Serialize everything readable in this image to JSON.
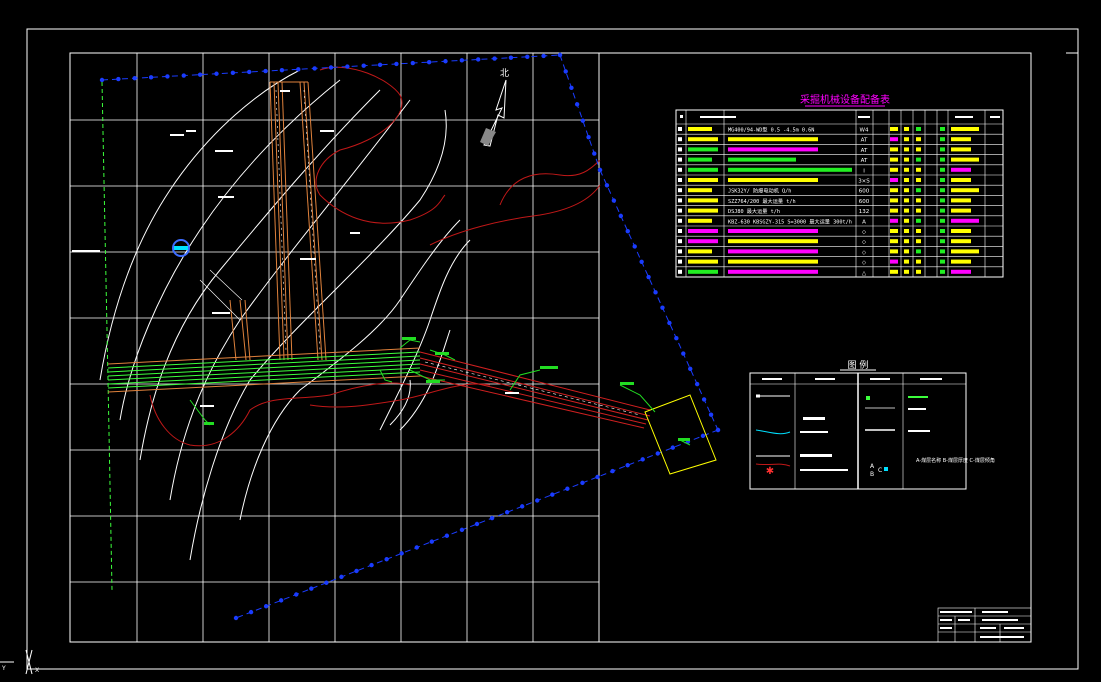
{
  "colors": {
    "background": "#000000",
    "frame": "#ffffff",
    "boundary_blue": "#1a3cff",
    "contour_white": "#ffffff",
    "contour_red": "#c01818",
    "pipe_green": "#3cff3c",
    "highlight_yellow": "#ffff00",
    "highlight_magenta": "#ff00ff",
    "highlight_green": "#22ee22",
    "roadway_orange": "#e0823c",
    "roadway_red": "#d02020",
    "label_green": "#22dd22",
    "label_cyan": "#00e0ff"
  },
  "north_label": "北",
  "cursor_axes": {
    "x_label": "X",
    "y_label": "Y"
  },
  "equipment_table": {
    "title": "采掘机械设备配备表",
    "rows": [
      {
        "spec": "MG400/94-WD型 0.5 -4.5m 0.6N",
        "code": "W4"
      },
      {
        "spec": "",
        "code": "AT"
      },
      {
        "spec": "",
        "code": "AT"
      },
      {
        "spec": "",
        "code": "AT"
      },
      {
        "spec": "",
        "code": "I"
      },
      {
        "spec": "",
        "code": "3×S"
      },
      {
        "spec": "JSK32Y/ 防爆电动机 Q/h",
        "code": "600"
      },
      {
        "spec": "SZZ764/200 最大运量 t/h",
        "code": "600"
      },
      {
        "spec": "DSJ80 最大运量 t/h",
        "code": "132"
      },
      {
        "spec": "KBZ-630 KBSGZY-315 S=3000 最大运量 300t/h",
        "code": "A"
      },
      {
        "spec": "",
        "code": "◇"
      },
      {
        "spec": "",
        "code": "◇"
      },
      {
        "spec": "",
        "code": "◇"
      },
      {
        "spec": "",
        "code": "◇"
      },
      {
        "spec": "",
        "code": "△"
      }
    ]
  },
  "legend": {
    "title": "图  例",
    "note": "A-煤层名称 B-煤层厚度 C-煤层倾角",
    "labels": {
      "abc": {
        "a": "A",
        "b": "B",
        "c": "C"
      }
    }
  }
}
